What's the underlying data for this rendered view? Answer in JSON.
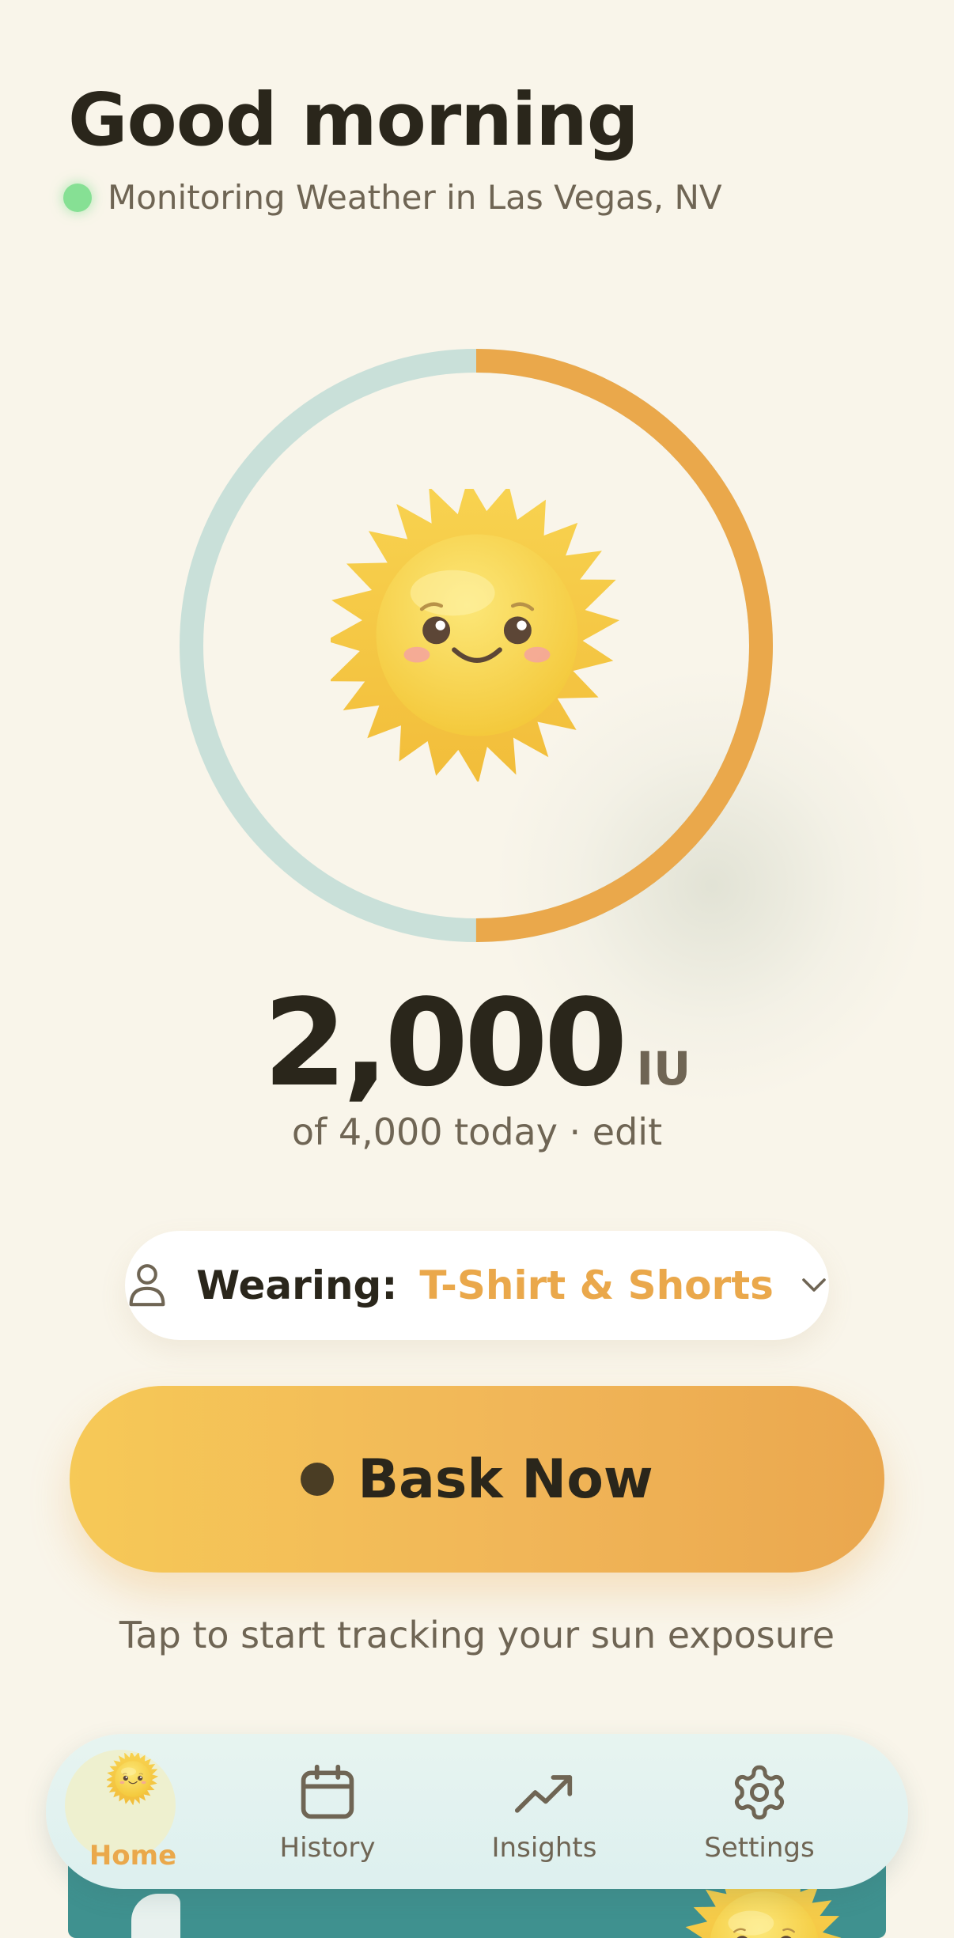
{
  "header": {
    "greeting": "Good morning",
    "status_text": "Monitoring Weather in Las Vegas, NV",
    "status_color": "#86e094"
  },
  "progress": {
    "value": "2,000",
    "unit": "IU",
    "goal_text": "of 4,000 today · edit",
    "current": 2000,
    "goal": 4000,
    "fraction": 0.5,
    "fill_color": "#eaa84b",
    "track_color": "#c9e0d9"
  },
  "mascot": {
    "icon": "smiling-sun-icon"
  },
  "wearing": {
    "label": "Wearing:",
    "value": "T-Shirt & Shorts",
    "icon": "person-icon",
    "accent_color": "#eaa84b"
  },
  "bask_button": {
    "label": "Bask Now"
  },
  "hint": "Tap to start tracking your sun exposure",
  "tabbar": {
    "tabs": [
      {
        "label": "Home",
        "icon": "sun-icon",
        "active": true
      },
      {
        "label": "History",
        "icon": "calendar-icon",
        "active": false
      },
      {
        "label": "Insights",
        "icon": "trending-up-icon",
        "active": false
      },
      {
        "label": "Settings",
        "icon": "gear-icon",
        "active": false
      }
    ]
  }
}
